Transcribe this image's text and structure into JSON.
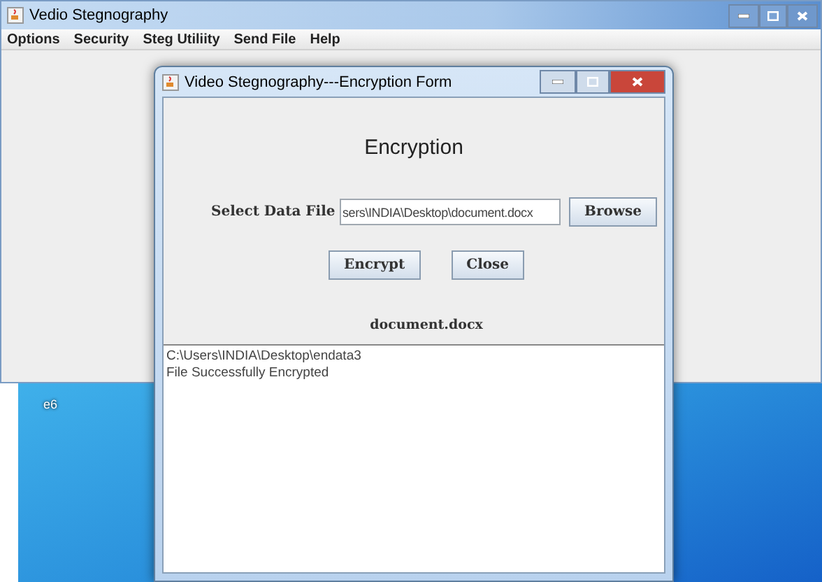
{
  "main_window": {
    "title": "Vedio Stegnography",
    "menu": [
      "Options",
      "Security",
      "Steg Utiliity",
      "Send File",
      "Help"
    ]
  },
  "desktop_icons": [
    {
      "label": "e6"
    }
  ],
  "dialog": {
    "title": "Video Stegnography---Encryption Form",
    "heading": "Encryption",
    "file_label": "Select Data File",
    "file_value": "sers\\INDIA\\Desktop\\document.docx",
    "browse_button": "Browse",
    "actions": [
      "Encrypt",
      "Close"
    ],
    "selected_file": "document.docx",
    "log": [
      "C:\\Users\\INDIA\\Desktop\\endata3",
      "File Successfully Encrypted"
    ]
  }
}
